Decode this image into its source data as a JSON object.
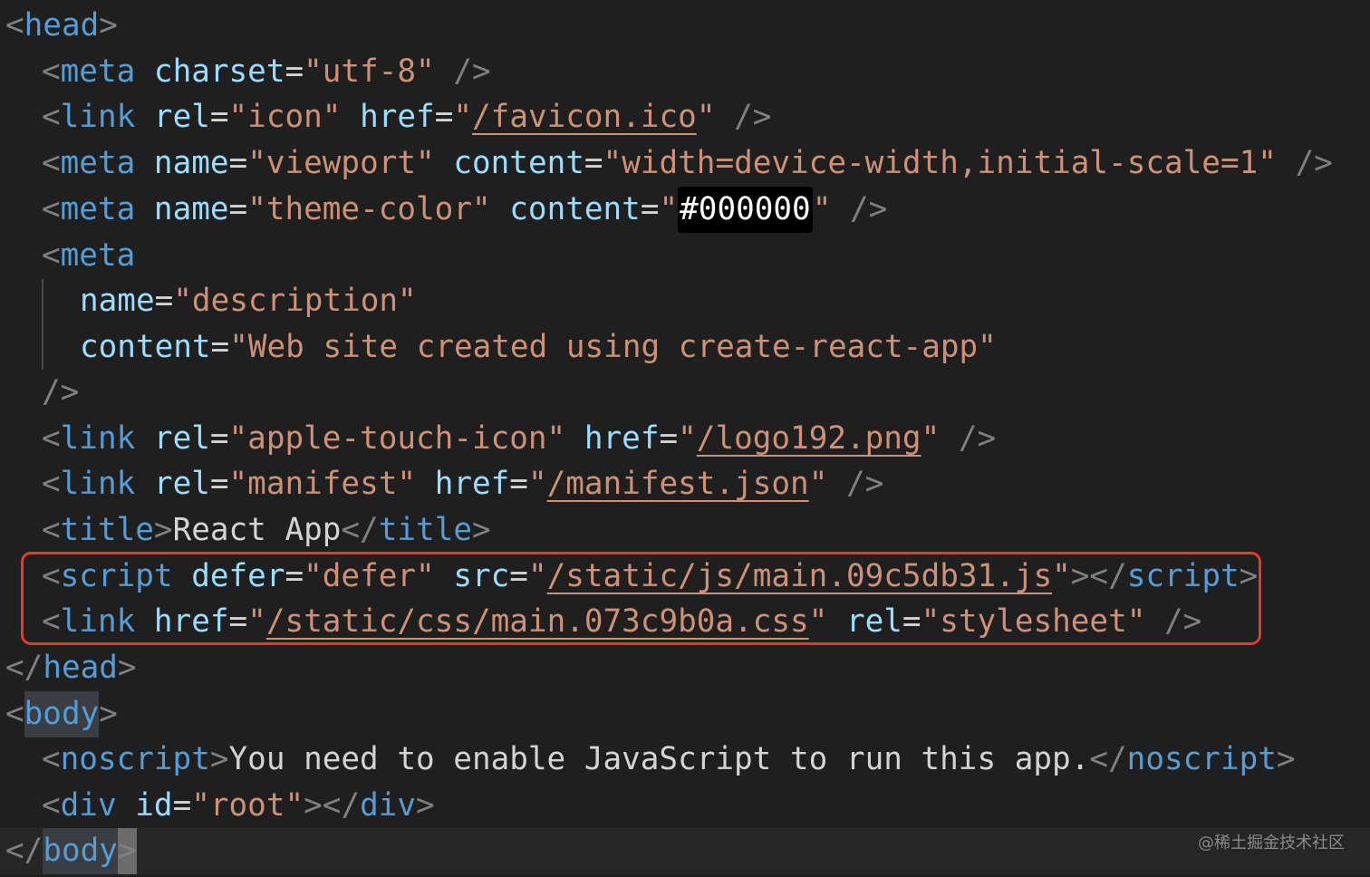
{
  "code": {
    "lines": [
      [
        [
          "<",
          "p"
        ],
        [
          "head",
          "t"
        ],
        [
          ">",
          "p"
        ]
      ],
      [
        [
          "<",
          "p"
        ],
        [
          "meta",
          "t"
        ],
        [
          " ",
          "x"
        ],
        [
          "charset",
          "a"
        ],
        [
          "=",
          "x"
        ],
        [
          "\"utf-8\"",
          "s"
        ],
        [
          " ",
          "x"
        ],
        [
          "/>",
          "p"
        ]
      ],
      [
        [
          "<",
          "p"
        ],
        [
          "link",
          "t"
        ],
        [
          " ",
          "x"
        ],
        [
          "rel",
          "a"
        ],
        [
          "=",
          "x"
        ],
        [
          "\"icon\"",
          "s"
        ],
        [
          " ",
          "x"
        ],
        [
          "href",
          "a"
        ],
        [
          "=",
          "x"
        ],
        [
          "\"",
          "s"
        ],
        [
          "/favicon.ico",
          "su"
        ],
        [
          "\"",
          "s"
        ],
        [
          " ",
          "x"
        ],
        [
          "/>",
          "p"
        ]
      ],
      [
        [
          "<",
          "p"
        ],
        [
          "meta",
          "t"
        ],
        [
          " ",
          "x"
        ],
        [
          "name",
          "a"
        ],
        [
          "=",
          "x"
        ],
        [
          "\"viewport\"",
          "s"
        ],
        [
          " ",
          "x"
        ],
        [
          "content",
          "a"
        ],
        [
          "=",
          "x"
        ],
        [
          "\"width=device-width,initial-scale=1\"",
          "s"
        ],
        [
          " ",
          "x"
        ],
        [
          "/>",
          "p"
        ]
      ],
      [
        [
          "<",
          "p"
        ],
        [
          "meta",
          "t"
        ],
        [
          " ",
          "x"
        ],
        [
          "name",
          "a"
        ],
        [
          "=",
          "x"
        ],
        [
          "\"theme-color\"",
          "s"
        ],
        [
          " ",
          "x"
        ],
        [
          "content",
          "a"
        ],
        [
          "=",
          "x"
        ],
        [
          "\"",
          "s"
        ],
        [
          "#000000",
          "sw"
        ],
        [
          "\"",
          "s"
        ],
        [
          " ",
          "x"
        ],
        [
          "/>",
          "p"
        ]
      ],
      [
        [
          "<",
          "p"
        ],
        [
          "meta",
          "t"
        ]
      ],
      [
        [
          "name",
          "a"
        ],
        [
          "=",
          "x"
        ],
        [
          "\"description\"",
          "s"
        ]
      ],
      [
        [
          "content",
          "a"
        ],
        [
          "=",
          "x"
        ],
        [
          "\"Web site created using create-react-app\"",
          "s"
        ]
      ],
      [
        [
          "/>",
          "p"
        ]
      ],
      [
        [
          "<",
          "p"
        ],
        [
          "link",
          "t"
        ],
        [
          " ",
          "x"
        ],
        [
          "rel",
          "a"
        ],
        [
          "=",
          "x"
        ],
        [
          "\"apple-touch-icon\"",
          "s"
        ],
        [
          " ",
          "x"
        ],
        [
          "href",
          "a"
        ],
        [
          "=",
          "x"
        ],
        [
          "\"",
          "s"
        ],
        [
          "/logo192.png",
          "su"
        ],
        [
          "\"",
          "s"
        ],
        [
          " ",
          "x"
        ],
        [
          "/>",
          "p"
        ]
      ],
      [
        [
          "<",
          "p"
        ],
        [
          "link",
          "t"
        ],
        [
          " ",
          "x"
        ],
        [
          "rel",
          "a"
        ],
        [
          "=",
          "x"
        ],
        [
          "\"manifest\"",
          "s"
        ],
        [
          " ",
          "x"
        ],
        [
          "href",
          "a"
        ],
        [
          "=",
          "x"
        ],
        [
          "\"",
          "s"
        ],
        [
          "/manifest.json",
          "su"
        ],
        [
          "\"",
          "s"
        ],
        [
          " ",
          "x"
        ],
        [
          "/>",
          "p"
        ]
      ],
      [
        [
          "<",
          "p"
        ],
        [
          "title",
          "t"
        ],
        [
          ">",
          "p"
        ],
        [
          "React App",
          "x"
        ],
        [
          "</",
          "p"
        ],
        [
          "title",
          "t"
        ],
        [
          ">",
          "p"
        ]
      ],
      [
        [
          "<",
          "p"
        ],
        [
          "script",
          "t"
        ],
        [
          " ",
          "x"
        ],
        [
          "defer",
          "a"
        ],
        [
          "=",
          "x"
        ],
        [
          "\"defer\"",
          "s"
        ],
        [
          " ",
          "x"
        ],
        [
          "src",
          "a"
        ],
        [
          "=",
          "x"
        ],
        [
          "\"",
          "s"
        ],
        [
          "/static/js/main.09c5db31.js",
          "su"
        ],
        [
          "\"",
          "s"
        ],
        [
          "></",
          "p"
        ],
        [
          "script",
          "t"
        ],
        [
          ">",
          "p"
        ]
      ],
      [
        [
          "<",
          "p"
        ],
        [
          "link",
          "t"
        ],
        [
          " ",
          "x"
        ],
        [
          "href",
          "a"
        ],
        [
          "=",
          "x"
        ],
        [
          "\"",
          "s"
        ],
        [
          "/static/css/main.073c9b0a.css",
          "su"
        ],
        [
          "\"",
          "s"
        ],
        [
          " ",
          "x"
        ],
        [
          "rel",
          "a"
        ],
        [
          "=",
          "x"
        ],
        [
          "\"stylesheet\"",
          "s"
        ],
        [
          " ",
          "x"
        ],
        [
          "/>",
          "p"
        ]
      ],
      [
        [
          "</",
          "p"
        ],
        [
          "head",
          "t"
        ],
        [
          ">",
          "p"
        ]
      ],
      [
        [
          "<",
          "p"
        ],
        [
          "body",
          "tm"
        ],
        [
          ">",
          "p"
        ]
      ],
      [
        [
          "<",
          "p"
        ],
        [
          "noscript",
          "t"
        ],
        [
          ">",
          "p"
        ],
        [
          "You need to enable JavaScript to run this app.",
          "x"
        ],
        [
          "</",
          "p"
        ],
        [
          "noscript",
          "t"
        ],
        [
          ">",
          "p"
        ]
      ],
      [
        [
          "<",
          "p"
        ],
        [
          "div",
          "t"
        ],
        [
          " ",
          "x"
        ],
        [
          "id",
          "a"
        ],
        [
          "=",
          "x"
        ],
        [
          "\"root\"",
          "s"
        ],
        [
          "></",
          "p"
        ],
        [
          "div",
          "t"
        ],
        [
          ">",
          "p"
        ]
      ],
      [
        [
          "</",
          "p"
        ],
        [
          "body",
          "tm"
        ],
        [
          ">",
          "pc"
        ]
      ]
    ]
  },
  "watermark": "@稀土掘金技术社区"
}
